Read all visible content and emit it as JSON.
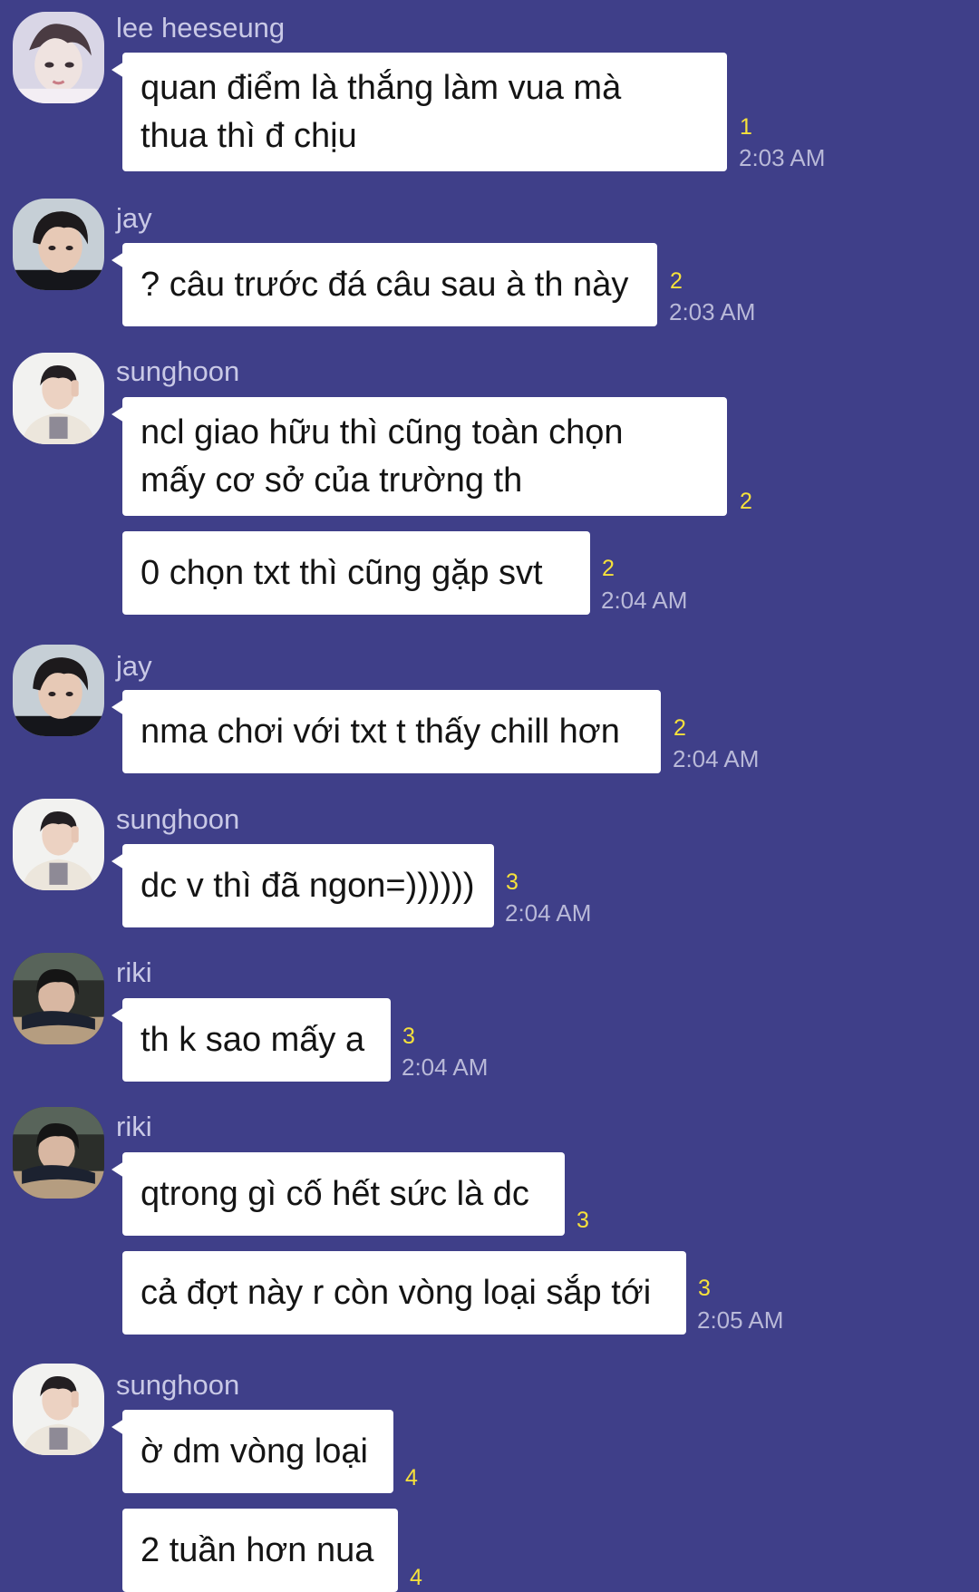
{
  "messages": [
    {
      "sender": "lee heeseung",
      "text": "quan điểm là thắng làm vua mà\nthua thì đ chịu",
      "unread": "1",
      "time": "2:03 AM"
    },
    {
      "sender": "jay",
      "text": "? câu trước đá câu sau à th này",
      "unread": "2",
      "time": "2:03 AM"
    },
    {
      "sender": "sunghoon",
      "text": "ncl giao hữu thì cũng toàn chọn\nmấy cơ sở của trường th",
      "unread": "2",
      "time": ""
    },
    {
      "sender": "",
      "text": "0 chọn txt thì cũng gặp svt",
      "unread": "2",
      "time": "2:04 AM"
    },
    {
      "sender": "jay",
      "text": "nma chơi với txt t thấy chill hơn",
      "unread": "2",
      "time": "2:04 AM"
    },
    {
      "sender": "sunghoon",
      "text": "dc v thì đã ngon=))))))",
      "unread": "3",
      "time": "2:04 AM"
    },
    {
      "sender": "riki",
      "text": "th k sao mấy a",
      "unread": "3",
      "time": "2:04 AM"
    },
    {
      "sender": "riki",
      "text": "qtrong gì cố hết sức là dc",
      "unread": "3",
      "time": ""
    },
    {
      "sender": "",
      "text": "cả đợt này r còn vòng loại sắp tới",
      "unread": "3",
      "time": "2:05 AM"
    },
    {
      "sender": "sunghoon",
      "text": "ờ dm vòng loại",
      "unread": "4",
      "time": ""
    },
    {
      "sender": "",
      "text": "2 tuần hơn nua",
      "unread": "4",
      "time": ""
    }
  ],
  "colors": {
    "background": "#3f3f89",
    "bubble": "#ffffff",
    "unread": "#f6e13b",
    "time": "#b9b9d8",
    "sender": "#c9c9e6"
  }
}
